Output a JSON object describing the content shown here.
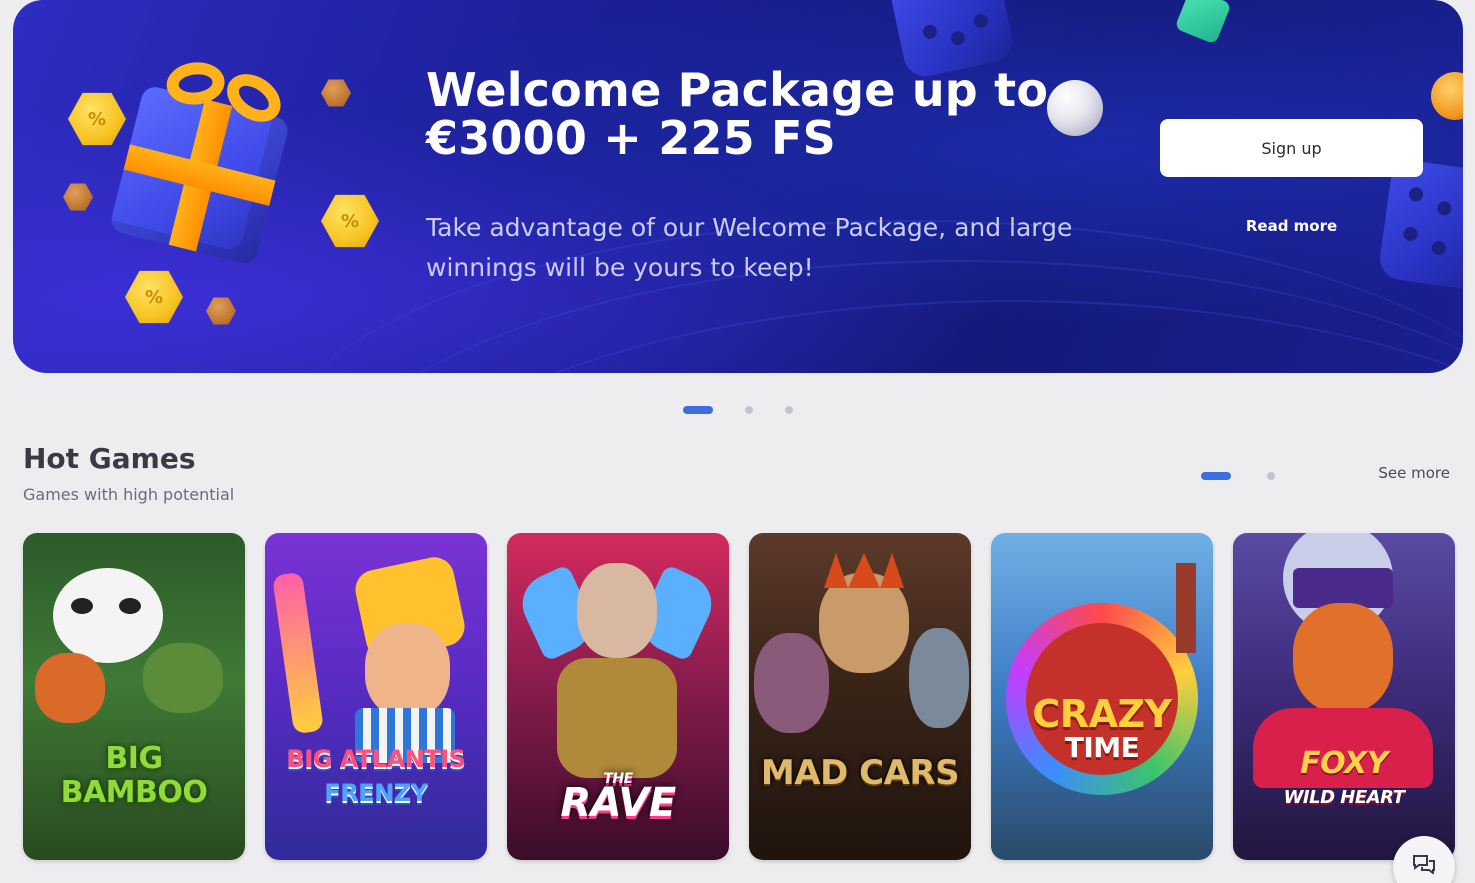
{
  "hero": {
    "title": "Welcome Package up to €3000 + 225 FS",
    "subtitle": "Take advantage of our Welcome Package, and large winnings will be yours to keep!",
    "signup_label": "Sign up",
    "read_more_label": "Read more",
    "coin_symbol": "%",
    "slides_total": 3,
    "active_slide": 1
  },
  "hot_games": {
    "title": "Hot Games",
    "subtitle": "Games with high potential",
    "see_more_label": "See more",
    "pages_total": 2,
    "active_page": 1,
    "games": [
      {
        "name": "BIG BAMBOO",
        "line1": "BIG",
        "line2": "BAMBOO",
        "bg": "#2f6b2a",
        "color": "#9be040"
      },
      {
        "name": "BIG ATLANTIS FRENZY",
        "line1": "BIG ATLANTIS",
        "line2": "FRENZY",
        "bg": "#5e2cc8",
        "color": "#ff4f7a"
      },
      {
        "name": "THE RAVE",
        "line1": "THE",
        "line2": "RAVE",
        "bg": "#8a1c4e",
        "color": "#ffffff"
      },
      {
        "name": "MAD CARS",
        "line1": "MAD CARS",
        "line2": "",
        "bg": "#4a2a1c",
        "color": "#e0b96a"
      },
      {
        "name": "CRAZY TIME",
        "line1": "CRAZY",
        "line2": "TIME",
        "bg": "#3c7bc4",
        "color": "#ffcf3c"
      },
      {
        "name": "FOXY WILD HEART",
        "line1": "FOXY",
        "line2": "WILD HEART",
        "bg": "#3c2a78",
        "color": "#ffd24a"
      }
    ]
  },
  "colors": {
    "accent": "#3c6ee0",
    "page_bg": "#ededf0",
    "hero_bg": "#1c1f98"
  },
  "icons": {
    "chat": "chat-bubbles-icon"
  }
}
